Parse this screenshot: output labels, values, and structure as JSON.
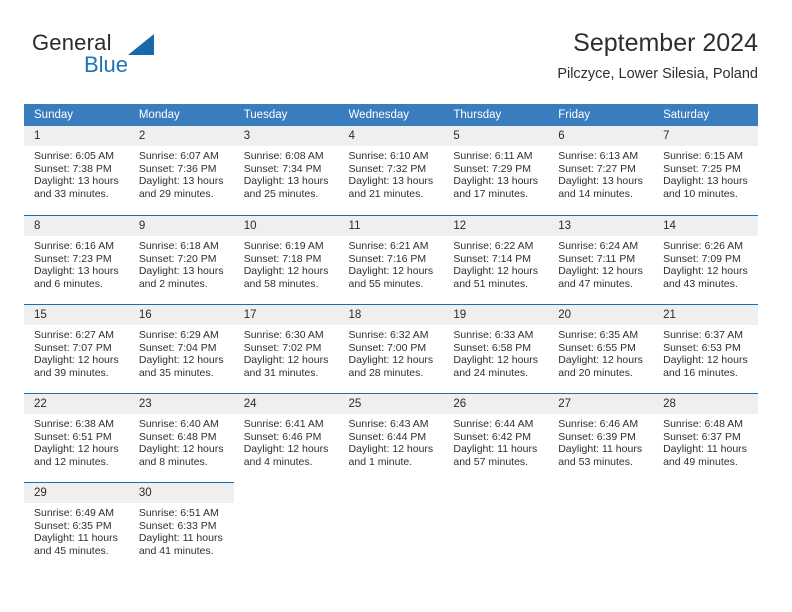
{
  "brand": {
    "name_part1": "General",
    "name_part2": "Blue",
    "mark": "triangle-logo"
  },
  "header": {
    "title": "September 2024",
    "subtitle": "Pilczyce, Lower Silesia, Poland"
  },
  "colors": {
    "header_blue": "#3a7dbf",
    "rule_blue": "#1b6eb3",
    "daynum_bg": "#efefef",
    "brand_blue": "#1e73b8"
  },
  "weekday_headers": [
    "Sunday",
    "Monday",
    "Tuesday",
    "Wednesday",
    "Thursday",
    "Friday",
    "Saturday"
  ],
  "weeks": [
    [
      {
        "day": "1",
        "sunrise": "Sunrise: 6:05 AM",
        "sunset": "Sunset: 7:38 PM",
        "daylight_line1": "Daylight: 13 hours",
        "daylight_line2": "and 33 minutes."
      },
      {
        "day": "2",
        "sunrise": "Sunrise: 6:07 AM",
        "sunset": "Sunset: 7:36 PM",
        "daylight_line1": "Daylight: 13 hours",
        "daylight_line2": "and 29 minutes."
      },
      {
        "day": "3",
        "sunrise": "Sunrise: 6:08 AM",
        "sunset": "Sunset: 7:34 PM",
        "daylight_line1": "Daylight: 13 hours",
        "daylight_line2": "and 25 minutes."
      },
      {
        "day": "4",
        "sunrise": "Sunrise: 6:10 AM",
        "sunset": "Sunset: 7:32 PM",
        "daylight_line1": "Daylight: 13 hours",
        "daylight_line2": "and 21 minutes."
      },
      {
        "day": "5",
        "sunrise": "Sunrise: 6:11 AM",
        "sunset": "Sunset: 7:29 PM",
        "daylight_line1": "Daylight: 13 hours",
        "daylight_line2": "and 17 minutes."
      },
      {
        "day": "6",
        "sunrise": "Sunrise: 6:13 AM",
        "sunset": "Sunset: 7:27 PM",
        "daylight_line1": "Daylight: 13 hours",
        "daylight_line2": "and 14 minutes."
      },
      {
        "day": "7",
        "sunrise": "Sunrise: 6:15 AM",
        "sunset": "Sunset: 7:25 PM",
        "daylight_line1": "Daylight: 13 hours",
        "daylight_line2": "and 10 minutes."
      }
    ],
    [
      {
        "day": "8",
        "sunrise": "Sunrise: 6:16 AM",
        "sunset": "Sunset: 7:23 PM",
        "daylight_line1": "Daylight: 13 hours",
        "daylight_line2": "and 6 minutes."
      },
      {
        "day": "9",
        "sunrise": "Sunrise: 6:18 AM",
        "sunset": "Sunset: 7:20 PM",
        "daylight_line1": "Daylight: 13 hours",
        "daylight_line2": "and 2 minutes."
      },
      {
        "day": "10",
        "sunrise": "Sunrise: 6:19 AM",
        "sunset": "Sunset: 7:18 PM",
        "daylight_line1": "Daylight: 12 hours",
        "daylight_line2": "and 58 minutes."
      },
      {
        "day": "11",
        "sunrise": "Sunrise: 6:21 AM",
        "sunset": "Sunset: 7:16 PM",
        "daylight_line1": "Daylight: 12 hours",
        "daylight_line2": "and 55 minutes."
      },
      {
        "day": "12",
        "sunrise": "Sunrise: 6:22 AM",
        "sunset": "Sunset: 7:14 PM",
        "daylight_line1": "Daylight: 12 hours",
        "daylight_line2": "and 51 minutes."
      },
      {
        "day": "13",
        "sunrise": "Sunrise: 6:24 AM",
        "sunset": "Sunset: 7:11 PM",
        "daylight_line1": "Daylight: 12 hours",
        "daylight_line2": "and 47 minutes."
      },
      {
        "day": "14",
        "sunrise": "Sunrise: 6:26 AM",
        "sunset": "Sunset: 7:09 PM",
        "daylight_line1": "Daylight: 12 hours",
        "daylight_line2": "and 43 minutes."
      }
    ],
    [
      {
        "day": "15",
        "sunrise": "Sunrise: 6:27 AM",
        "sunset": "Sunset: 7:07 PM",
        "daylight_line1": "Daylight: 12 hours",
        "daylight_line2": "and 39 minutes."
      },
      {
        "day": "16",
        "sunrise": "Sunrise: 6:29 AM",
        "sunset": "Sunset: 7:04 PM",
        "daylight_line1": "Daylight: 12 hours",
        "daylight_line2": "and 35 minutes."
      },
      {
        "day": "17",
        "sunrise": "Sunrise: 6:30 AM",
        "sunset": "Sunset: 7:02 PM",
        "daylight_line1": "Daylight: 12 hours",
        "daylight_line2": "and 31 minutes."
      },
      {
        "day": "18",
        "sunrise": "Sunrise: 6:32 AM",
        "sunset": "Sunset: 7:00 PM",
        "daylight_line1": "Daylight: 12 hours",
        "daylight_line2": "and 28 minutes."
      },
      {
        "day": "19",
        "sunrise": "Sunrise: 6:33 AM",
        "sunset": "Sunset: 6:58 PM",
        "daylight_line1": "Daylight: 12 hours",
        "daylight_line2": "and 24 minutes."
      },
      {
        "day": "20",
        "sunrise": "Sunrise: 6:35 AM",
        "sunset": "Sunset: 6:55 PM",
        "daylight_line1": "Daylight: 12 hours",
        "daylight_line2": "and 20 minutes."
      },
      {
        "day": "21",
        "sunrise": "Sunrise: 6:37 AM",
        "sunset": "Sunset: 6:53 PM",
        "daylight_line1": "Daylight: 12 hours",
        "daylight_line2": "and 16 minutes."
      }
    ],
    [
      {
        "day": "22",
        "sunrise": "Sunrise: 6:38 AM",
        "sunset": "Sunset: 6:51 PM",
        "daylight_line1": "Daylight: 12 hours",
        "daylight_line2": "and 12 minutes."
      },
      {
        "day": "23",
        "sunrise": "Sunrise: 6:40 AM",
        "sunset": "Sunset: 6:48 PM",
        "daylight_line1": "Daylight: 12 hours",
        "daylight_line2": "and 8 minutes."
      },
      {
        "day": "24",
        "sunrise": "Sunrise: 6:41 AM",
        "sunset": "Sunset: 6:46 PM",
        "daylight_line1": "Daylight: 12 hours",
        "daylight_line2": "and 4 minutes."
      },
      {
        "day": "25",
        "sunrise": "Sunrise: 6:43 AM",
        "sunset": "Sunset: 6:44 PM",
        "daylight_line1": "Daylight: 12 hours",
        "daylight_line2": "and 1 minute."
      },
      {
        "day": "26",
        "sunrise": "Sunrise: 6:44 AM",
        "sunset": "Sunset: 6:42 PM",
        "daylight_line1": "Daylight: 11 hours",
        "daylight_line2": "and 57 minutes."
      },
      {
        "day": "27",
        "sunrise": "Sunrise: 6:46 AM",
        "sunset": "Sunset: 6:39 PM",
        "daylight_line1": "Daylight: 11 hours",
        "daylight_line2": "and 53 minutes."
      },
      {
        "day": "28",
        "sunrise": "Sunrise: 6:48 AM",
        "sunset": "Sunset: 6:37 PM",
        "daylight_line1": "Daylight: 11 hours",
        "daylight_line2": "and 49 minutes."
      }
    ],
    [
      {
        "day": "29",
        "sunrise": "Sunrise: 6:49 AM",
        "sunset": "Sunset: 6:35 PM",
        "daylight_line1": "Daylight: 11 hours",
        "daylight_line2": "and 45 minutes."
      },
      {
        "day": "30",
        "sunrise": "Sunrise: 6:51 AM",
        "sunset": "Sunset: 6:33 PM",
        "daylight_line1": "Daylight: 11 hours",
        "daylight_line2": "and 41 minutes."
      },
      {
        "day": "",
        "sunrise": "",
        "sunset": "",
        "daylight_line1": "",
        "daylight_line2": ""
      },
      {
        "day": "",
        "sunrise": "",
        "sunset": "",
        "daylight_line1": "",
        "daylight_line2": ""
      },
      {
        "day": "",
        "sunrise": "",
        "sunset": "",
        "daylight_line1": "",
        "daylight_line2": ""
      },
      {
        "day": "",
        "sunrise": "",
        "sunset": "",
        "daylight_line1": "",
        "daylight_line2": ""
      },
      {
        "day": "",
        "sunrise": "",
        "sunset": "",
        "daylight_line1": "",
        "daylight_line2": ""
      }
    ]
  ]
}
